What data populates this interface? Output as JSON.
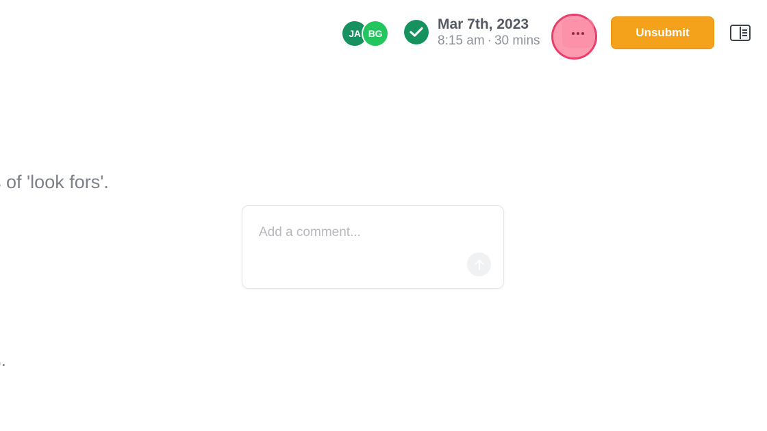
{
  "header": {
    "avatars": [
      {
        "initials": "JA",
        "color": "#17915f"
      },
      {
        "initials": "BG",
        "color": "#22c55e"
      }
    ],
    "status_icon": "check-circle-icon",
    "session": {
      "date": "Mar 7th, 2023",
      "time": "8:15 am",
      "separator": "·",
      "duration": "30 mins"
    },
    "more_icon": "ellipsis-icon",
    "unsubmit_label": "Unsubmit",
    "panel_toggle_icon": "sidebar-toggle-icon"
  },
  "content": {
    "line_1": "s of 'look fors'.",
    "line_2": "s."
  },
  "comment": {
    "placeholder": "Add a comment...",
    "value": "",
    "send_icon": "arrow-up-icon"
  },
  "colors": {
    "accent_orange": "#f4a11b",
    "status_green": "#16925f",
    "highlight_pink": "#ea3d6b"
  }
}
